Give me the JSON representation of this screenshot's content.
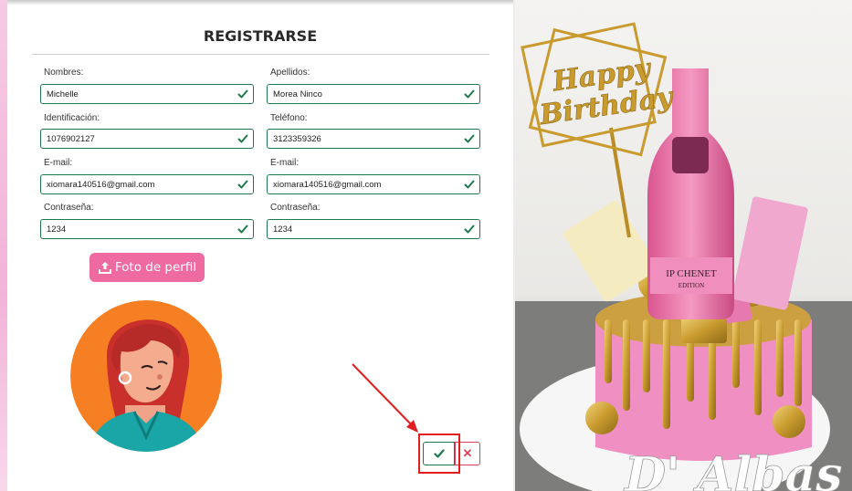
{
  "form": {
    "title": "REGISTRARSE",
    "fields": [
      {
        "label": "Nombres:",
        "value": "Michelle"
      },
      {
        "label": "Apellidos:",
        "value": "Morea Ninco"
      },
      {
        "label": "Identificación:",
        "value": "1076902127"
      },
      {
        "label": "Teléfono:",
        "value": "3123359326"
      },
      {
        "label": "E-mail:",
        "value": "xiomara140516@gmail.com"
      },
      {
        "label": "E-mail:",
        "value": "xiomara140516@gmail.com"
      },
      {
        "label": "Contraseña:",
        "value": "1234"
      },
      {
        "label": "Contraseña:",
        "value": "1234"
      }
    ],
    "upload_button": {
      "label": "Foto de perfil",
      "icon": "upload-icon"
    },
    "confirm_icon": "check-icon",
    "cancel_icon": "x-icon",
    "cancel_glyph": "✕"
  },
  "colors": {
    "valid_border": "#1e7a4d",
    "accent_pink": "#ef6aa1",
    "cancel_red": "#d9435a",
    "annotation_red": "#e21f1f"
  },
  "photo": {
    "topper_line1": "Happy",
    "topper_line2": "Birthday",
    "bottle_label": "IP CHENET",
    "bottle_sublabel": "EDITION",
    "watermark": "D' Albas"
  }
}
